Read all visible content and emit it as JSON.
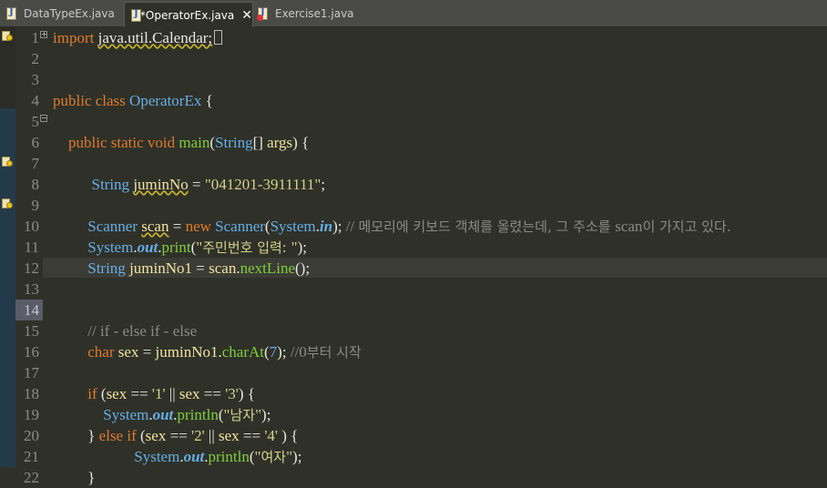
{
  "tabs": [
    {
      "label": "DataTypeEx.java"
    },
    {
      "label": "*OperatorEx.java"
    },
    {
      "label": "Exercise1.java"
    }
  ],
  "lines": {
    "l1": {
      "n": "1",
      "t": [
        [
          "kw",
          "import "
        ],
        [
          "pl sq",
          "java.util.Calendar;"
        ]
      ]
    },
    "l2": {
      "n": "2",
      "t": []
    },
    "l3": {
      "n": "3",
      "t": []
    },
    "l4": {
      "n": "4",
      "t": [
        [
          "kw",
          "public class "
        ],
        [
          "ty",
          "OperatorEx"
        ],
        [
          "pl",
          " {"
        ]
      ]
    },
    "l5": {
      "n": "5",
      "t": []
    },
    "l6": {
      "n": "6",
      "t": [
        [
          "kw",
          "    public static void "
        ],
        [
          "fn",
          "main"
        ],
        [
          "pl",
          "("
        ],
        [
          "ty",
          "String"
        ],
        [
          "pl",
          "[] "
        ],
        [
          "va",
          "args"
        ],
        [
          "pl",
          ") {"
        ]
      ]
    },
    "l7": {
      "n": "7",
      "t": []
    },
    "l8": {
      "n": "8",
      "t": [
        [
          "ty",
          "          String "
        ],
        [
          "va sq",
          "juminNo"
        ],
        [
          "pl",
          " = "
        ],
        [
          "st",
          "\"041201-3911111\""
        ],
        [
          "pl",
          ";"
        ]
      ]
    },
    "l9": {
      "n": "9",
      "t": []
    },
    "l10": {
      "n": "10",
      "t": [
        [
          "ty",
          "         Scanner "
        ],
        [
          "va sq",
          "scan"
        ],
        [
          "pl",
          " = "
        ],
        [
          "kw",
          "new "
        ],
        [
          "ty",
          "Scanner"
        ],
        [
          "pl",
          "("
        ],
        [
          "ty",
          "System"
        ],
        [
          "pl",
          "."
        ],
        [
          "fi",
          "in"
        ],
        [
          "pl",
          "); "
        ],
        [
          "cm",
          "// "
        ],
        [
          "cm ko",
          "메모리에 키보드 객체를 올렸는데, 그 주소를 "
        ],
        [
          "cm",
          "scan"
        ],
        [
          "cm ko",
          "이 가지고 있다."
        ]
      ]
    },
    "l11": {
      "n": "11",
      "t": [
        [
          "ty",
          "         System"
        ],
        [
          "pl",
          "."
        ],
        [
          "fi",
          "out"
        ],
        [
          "pl",
          "."
        ],
        [
          "fn",
          "print"
        ],
        [
          "pl",
          "("
        ],
        [
          "st",
          "\""
        ],
        [
          "st ko",
          "주민번호 입력: "
        ],
        [
          "st",
          "\""
        ],
        [
          "pl",
          ");"
        ]
      ]
    },
    "l12": {
      "n": "12",
      "t": [
        [
          "ty",
          "         String "
        ],
        [
          "va",
          "juminNo1"
        ],
        [
          "pl",
          " = "
        ],
        [
          "va",
          "scan"
        ],
        [
          "pl",
          "."
        ],
        [
          "fn",
          "nextLine"
        ],
        [
          "pl",
          "();"
        ]
      ]
    },
    "l13": {
      "n": "13",
      "t": []
    },
    "l14": {
      "n": "14",
      "t": []
    },
    "l15": {
      "n": "15",
      "t": [
        [
          "cm",
          "         // if - else if - else"
        ]
      ]
    },
    "l16": {
      "n": "16",
      "t": [
        [
          "kw",
          "         char "
        ],
        [
          "va",
          "sex"
        ],
        [
          "pl",
          " = "
        ],
        [
          "va",
          "juminNo1"
        ],
        [
          "pl",
          "."
        ],
        [
          "fn",
          "charAt"
        ],
        [
          "pl",
          "("
        ],
        [
          "ty",
          "7"
        ],
        [
          "pl",
          "); "
        ],
        [
          "cm",
          "//0"
        ],
        [
          "cm ko",
          "부터 시작"
        ]
      ]
    },
    "l17": {
      "n": "17",
      "t": []
    },
    "l18": {
      "n": "18",
      "t": [
        [
          "kw",
          "         if "
        ],
        [
          "pl",
          "("
        ],
        [
          "va",
          "sex"
        ],
        [
          "pl",
          " == "
        ],
        [
          "st",
          "'1'"
        ],
        [
          "pl",
          " || "
        ],
        [
          "va",
          "sex"
        ],
        [
          "pl",
          " == "
        ],
        [
          "st",
          "'3'"
        ],
        [
          "pl",
          ") {"
        ]
      ]
    },
    "l19": {
      "n": "19",
      "t": [
        [
          "ty",
          "             System"
        ],
        [
          "pl",
          "."
        ],
        [
          "fi",
          "out"
        ],
        [
          "pl",
          "."
        ],
        [
          "fn",
          "println"
        ],
        [
          "pl",
          "("
        ],
        [
          "st",
          "\""
        ],
        [
          "st ko",
          "남자"
        ],
        [
          "st",
          "\""
        ],
        [
          "pl",
          ");"
        ]
      ]
    },
    "l20": {
      "n": "20",
      "t": [
        [
          "pl",
          "         } "
        ],
        [
          "kw",
          "else if "
        ],
        [
          "pl",
          "("
        ],
        [
          "va",
          "sex"
        ],
        [
          "pl",
          " == "
        ],
        [
          "st",
          "'2'"
        ],
        [
          "pl",
          " || "
        ],
        [
          "va",
          "sex"
        ],
        [
          "pl",
          " == "
        ],
        [
          "st",
          "'4'"
        ],
        [
          "pl",
          " ) {"
        ]
      ]
    },
    "l21": {
      "n": "21",
      "t": [
        [
          "ty",
          "                     System"
        ],
        [
          "pl",
          "."
        ],
        [
          "fi",
          "out"
        ],
        [
          "pl",
          "."
        ],
        [
          "fn",
          "println"
        ],
        [
          "pl",
          "("
        ],
        [
          "st",
          "\""
        ],
        [
          "st ko",
          "여자"
        ],
        [
          "st",
          "\""
        ],
        [
          "pl",
          ");"
        ]
      ]
    },
    "l22": {
      "n": "22",
      "t": [
        [
          "pl",
          "         }"
        ]
      ]
    }
  },
  "colors": {
    "background": "#2f3129",
    "keyword": "#e07b2d",
    "type": "#66aee8",
    "method": "#7fcf3d",
    "string": "#d6d28a",
    "comment": "#8a8a85"
  },
  "icons": {
    "tab_file": "java-file-icon",
    "error_overlay": "error-badge-icon",
    "marker": "warning-bulb-icon",
    "fold": "fold-toggle-icon",
    "close": "close-icon"
  }
}
